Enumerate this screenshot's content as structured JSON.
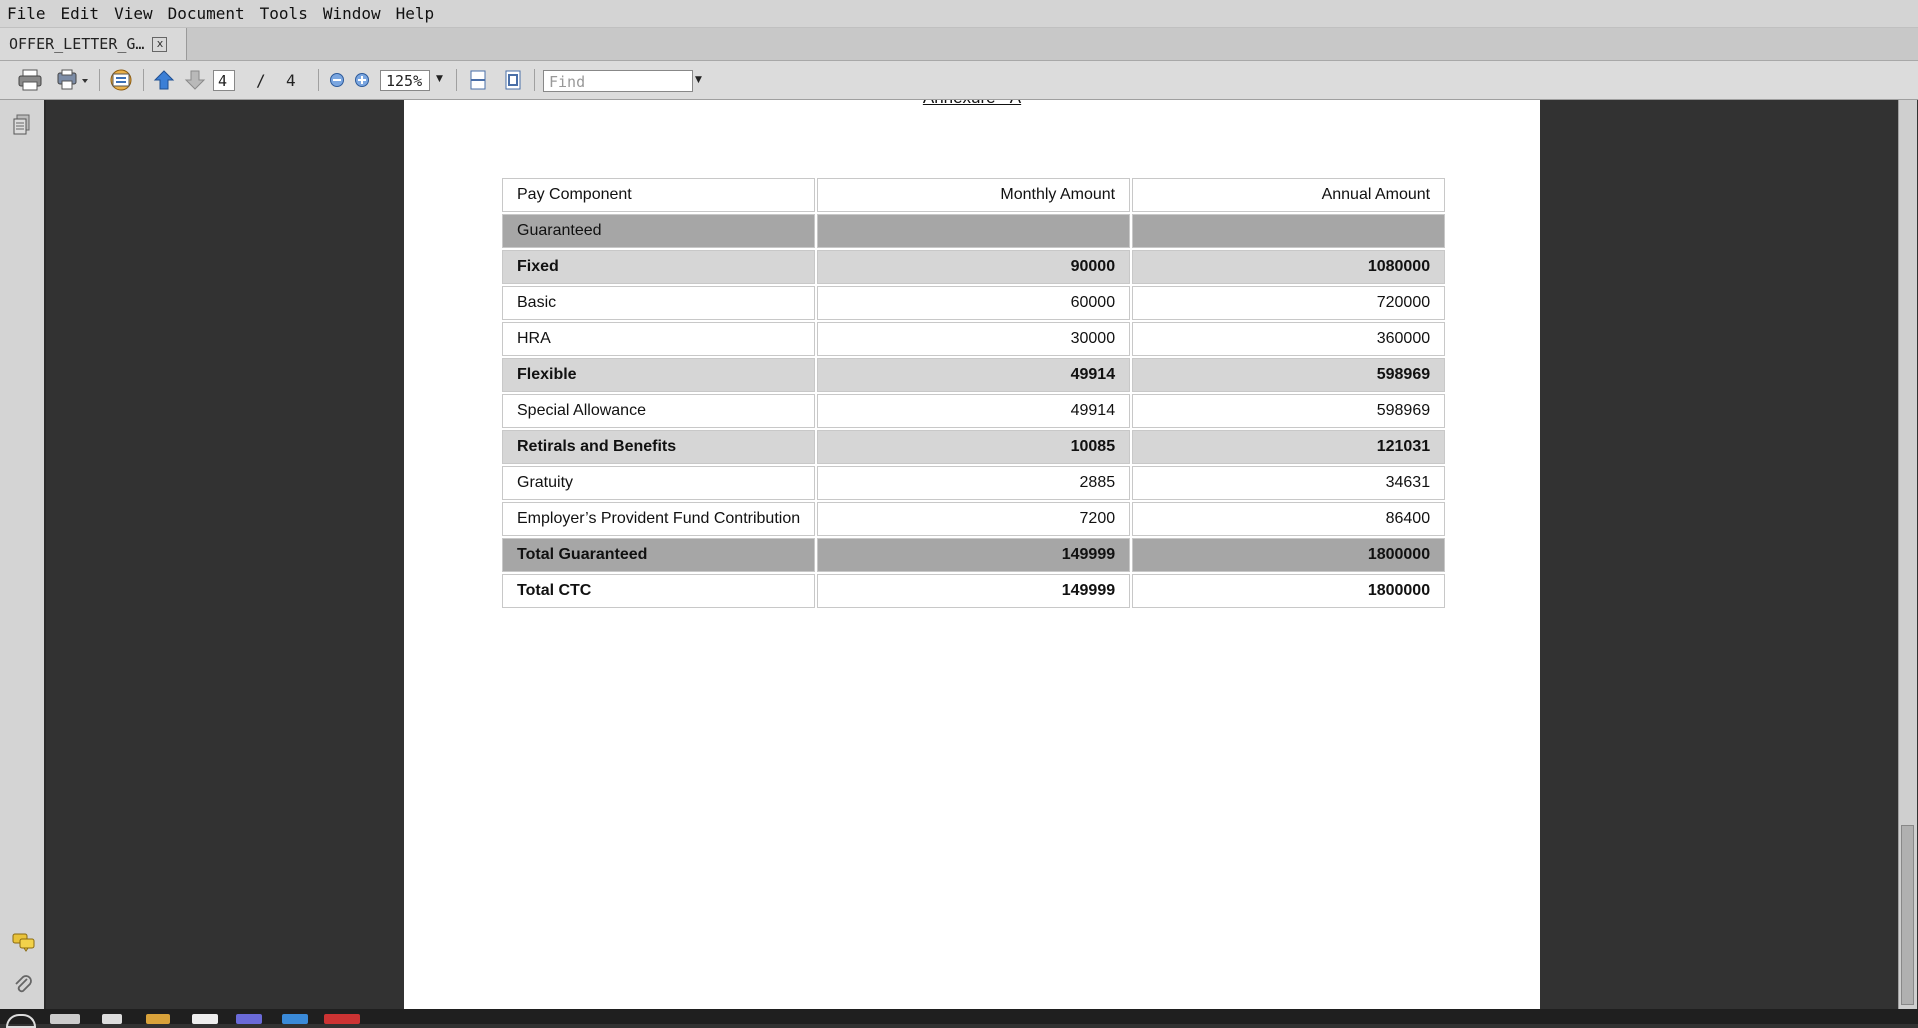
{
  "menubar": {
    "items": [
      "File",
      "Edit",
      "View",
      "Document",
      "Tools",
      "Window",
      "Help"
    ]
  },
  "tabs": [
    {
      "label": "OFFER_LETTER_G…",
      "close": "x"
    }
  ],
  "toolbar": {
    "current_page": "4",
    "page_separator": "/",
    "total_pages": "4",
    "zoom": "125%",
    "find_placeholder": "Find",
    "icons": [
      "print-icon",
      "print-setup-icon",
      "properties-icon",
      "prev-page-icon",
      "next-page-icon",
      "zoom-out-icon",
      "zoom-in-icon",
      "fit-width-icon",
      "fit-page-icon"
    ]
  },
  "leftpanel": {
    "icons": [
      "pages-icon",
      "comments-icon",
      "attachments-icon"
    ]
  },
  "document": {
    "annex_title": "Annexure - A",
    "table": {
      "headers": [
        "Pay Component",
        "Monthly Amount",
        "Annual Amount"
      ],
      "rows": [
        {
          "kind": "group",
          "label": "Guaranteed",
          "monthly": "",
          "annual": ""
        },
        {
          "kind": "sub",
          "label": "Fixed",
          "monthly": "90000",
          "annual": "1080000"
        },
        {
          "kind": "item",
          "label": "Basic",
          "monthly": "60000",
          "annual": "720000"
        },
        {
          "kind": "item",
          "label": "HRA",
          "monthly": "30000",
          "annual": "360000"
        },
        {
          "kind": "sub",
          "label": "Flexible",
          "monthly": "49914",
          "annual": "598969"
        },
        {
          "kind": "item",
          "label": "Special Allowance",
          "monthly": "49914",
          "annual": "598969"
        },
        {
          "kind": "sub",
          "label": "Retirals and Benefits",
          "monthly": "10085",
          "annual": "121031"
        },
        {
          "kind": "item",
          "label": "Gratuity",
          "monthly": "2885",
          "annual": "34631"
        },
        {
          "kind": "item",
          "label": "Employer’s Provident Fund Contribution",
          "monthly": "7200",
          "annual": "86400"
        },
        {
          "kind": "total",
          "label": "Total Guaranteed",
          "monthly": "149999",
          "annual": "1800000"
        },
        {
          "kind": "ctc",
          "label": "Total CTC",
          "monthly": "149999",
          "annual": "1800000"
        }
      ]
    }
  },
  "colors": {
    "workspace": "#323232",
    "group_row": "#a6a6a6",
    "sub_row": "#d6d6d6",
    "chrome": "#d4d4d4"
  }
}
